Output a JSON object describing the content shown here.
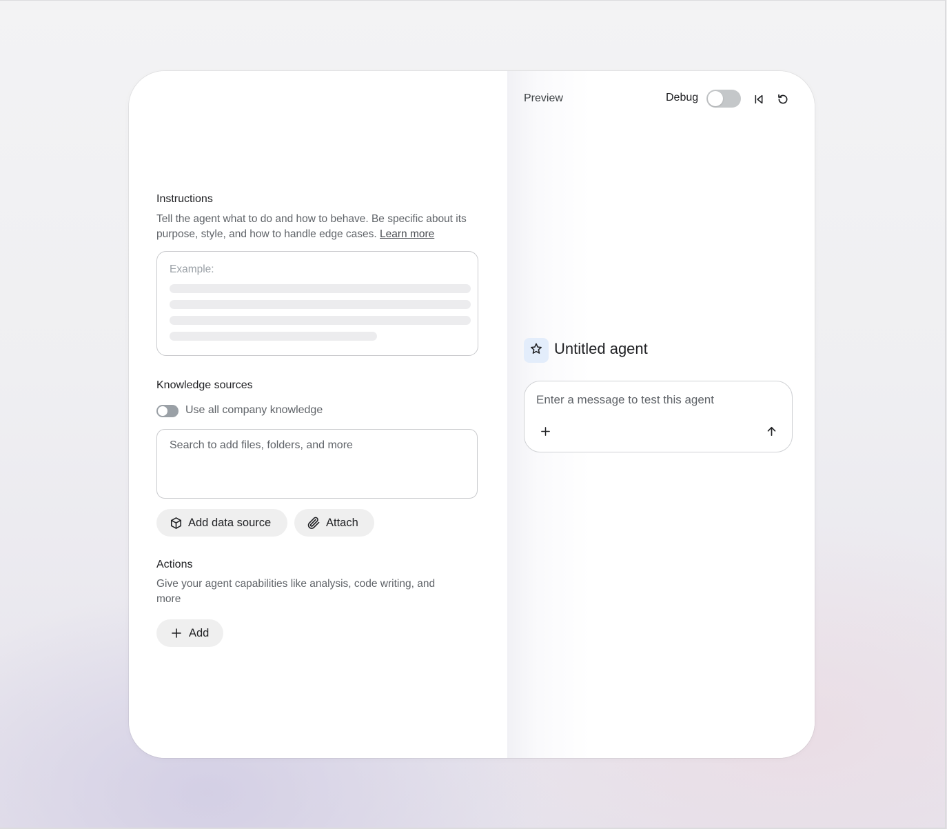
{
  "instructions": {
    "title": "Instructions",
    "description": "Tell the agent what to do and how to behave. Be specific about its purpose, style, and how to handle edge cases.",
    "learn_more": "Learn more",
    "example_label": "Example:"
  },
  "knowledge": {
    "title": "Knowledge sources",
    "toggle_label": "Use all company knowledge",
    "toggle_on": false,
    "search_placeholder": "Search to add files, folders, and more",
    "add_data_source_label": "Add data source",
    "add_data_source_icon": "cube-icon",
    "attach_label": "Attach",
    "attach_icon": "paperclip-icon"
  },
  "actions": {
    "title": "Actions",
    "description": "Give your agent capabilities like analysis, code writing, and more",
    "add_label": "Add",
    "add_icon": "plus-icon"
  },
  "preview": {
    "title": "Preview",
    "debug_label": "Debug",
    "debug_on": false,
    "skip_back_icon": "skip-back-icon",
    "reset_icon": "reset-icon",
    "agent_icon": "star-icon",
    "agent_name": "Untitled agent",
    "message_placeholder": "Enter a message to test this agent",
    "add_icon": "plus-icon",
    "send_icon": "arrow-up-icon"
  },
  "colors": {
    "agent_badge_bg": "#e3edfb",
    "toggle_off": "#c4c7c9",
    "pill_bg": "#efefef"
  }
}
